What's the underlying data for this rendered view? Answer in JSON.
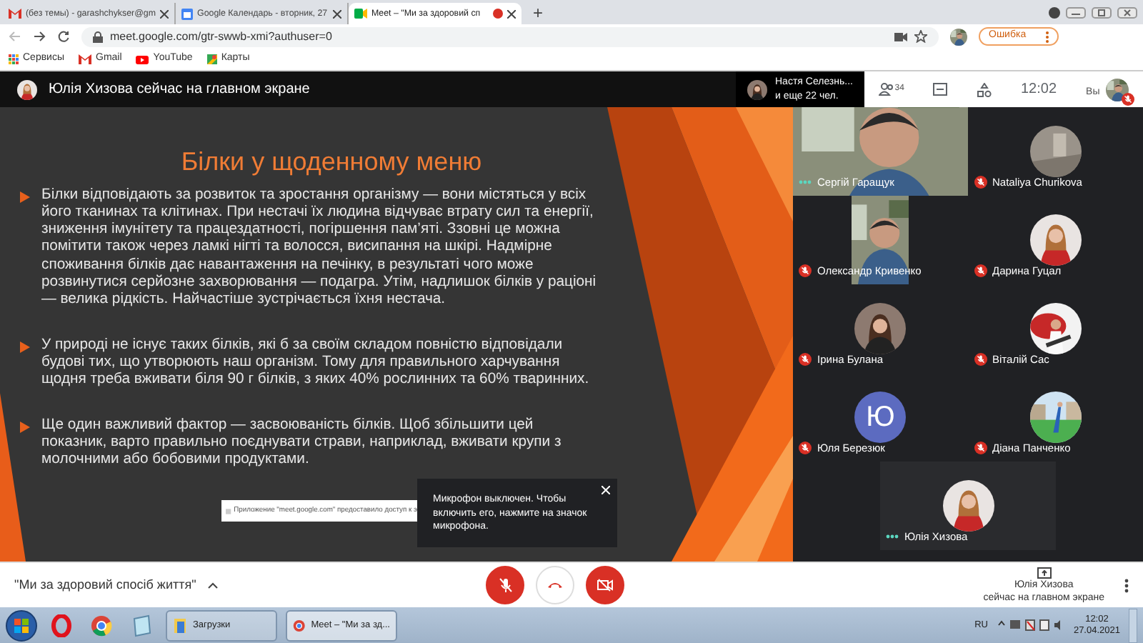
{
  "browser": {
    "tabs": [
      {
        "title": "(без темы) - garashchykser@gm",
        "selected": false
      },
      {
        "title": "Google Календарь - вторник, 27",
        "selected": false
      },
      {
        "title": "Meet – \"Ми за здоровий сп",
        "selected": true
      }
    ],
    "new_tab": "+",
    "address": "meet.google.com/gtr-swwb-xmi?authuser=0",
    "profile_button": "Ошибка",
    "bookmarks": [
      "Сервисы",
      "Gmail",
      "YouTube",
      "Карты"
    ]
  },
  "meet": {
    "presenter_banner": "Юлія Хизова сейчас на главном экране",
    "others_name": "Настя Селезнь...",
    "others_more": "и еще 22 чел.",
    "people_count": "34",
    "clock": "12:02",
    "self_label": "Вы"
  },
  "slide": {
    "title": "Білки у щоденному меню",
    "bullets": [
      "Білки відповідають за розвиток та зростання організму — вони містяться у всіх його тканинах та клітинах. При нестачі їх людина відчуває втрату сил та енергії, зниження імунітету та працездатності, погіршення пам’яті. Ззовні це можна помітити також через ламкі нігті та волосся, висипання на шкірі. Надмірне споживання білків дає навантаження на печінку, в результаті чого може розвинутися серйозне захворювання — подагра. Утім, надлишок білків у раціоні — велика рідкість. Найчастіше зустрічається їхня нестача.",
      "У природі не існує таких білків, які б за своїм складом повністю відповідали будові тих, що утворюють наш організм. Тому для правильного харчування щодня треба вживати біля 90 г білків, з яких 40% рослинних та 60% тваринних.",
      "Ще один важливий фактор — засвоюваність білків. Щоб збільшити цей показник, варто правильно поєднувати страви, наприклад, вживати крупи з молочними або бобовими продуктами."
    ]
  },
  "participants": [
    {
      "name": "Сергій Гаращук",
      "kind": "video",
      "muted": false
    },
    {
      "name": "Nataliya Churikova",
      "muted": true
    },
    {
      "name": "Олександр Кривенко",
      "kind": "portrait-video",
      "muted": true
    },
    {
      "name": "Дарина Гуцал",
      "muted": true
    },
    {
      "name": "Ірина Булана",
      "muted": true
    },
    {
      "name": "Віталій Сас",
      "muted": true
    },
    {
      "name": "Юля Березюк",
      "kind": "letter",
      "letter": "Ю",
      "color": "#5c6bc0",
      "muted": true
    },
    {
      "name": "Діана Панченко",
      "muted": true
    },
    {
      "name": "Юлія Хизова",
      "muted": false
    }
  ],
  "notification": "Приложение \"meet.google.com\" предоставило доступ к э",
  "tooltip": "Микрофон выключен. Чтобы включить его, нажмите на значок микрофона.",
  "bottom_bar": {
    "meeting_title": "\"Ми за здоровий спосіб життя\"",
    "mic_on": false,
    "camera_on": false,
    "presenter_name": "Юлія Хизова",
    "presenter_status": "сейчас на главном экране"
  },
  "taskbar": {
    "tasks": [
      {
        "label": "Загрузки",
        "selected": false
      },
      {
        "label": "Meet – \"Ми за зд...",
        "selected": true
      }
    ],
    "language": "RU",
    "time": "12:02",
    "date": "27.04.2021"
  }
}
